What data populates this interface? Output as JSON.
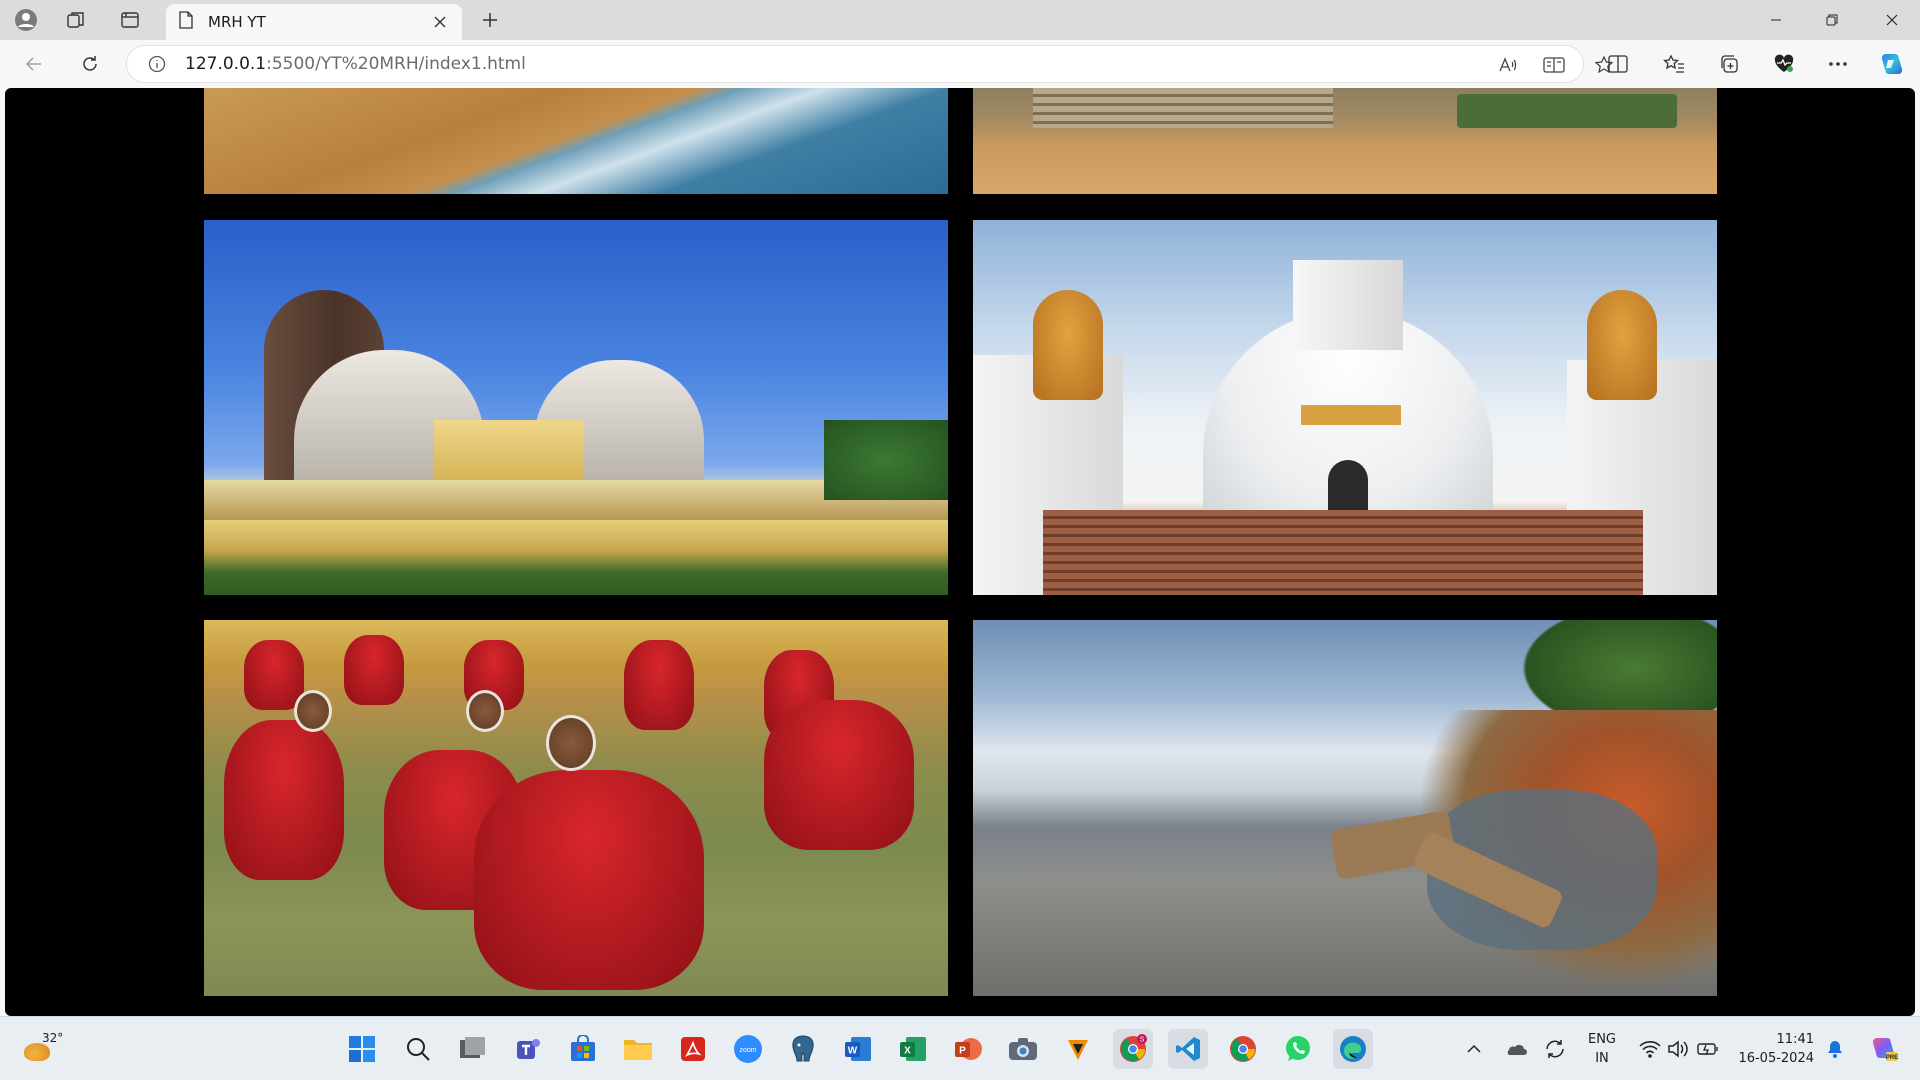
{
  "browser": {
    "tab_title": "MRH YT",
    "url_host": "127.0.0.1",
    "url_rest": ":5500/YT%20MRH/index1.html"
  },
  "gallery": {
    "images": [
      {
        "subject": "beach shoreline (partially scrolled)"
      },
      {
        "subject": "stone steps with visitors (partially scrolled)"
      },
      {
        "subject": "temple complex under blue sky"
      },
      {
        "subject": "white peace pagoda with lion statues"
      },
      {
        "subject": "odissi dancers on field"
      },
      {
        "subject": "rocky coastline at low tide"
      }
    ]
  },
  "taskbar": {
    "temperature": "32°",
    "language_line1": "ENG",
    "language_line2": "IN",
    "time": "11:41",
    "date": "16-05-2024",
    "apps": [
      "start",
      "search",
      "task-view",
      "teams",
      "store",
      "file-explorer",
      "acrobat",
      "zoom",
      "postgres",
      "word",
      "excel",
      "powerpoint",
      "camera",
      "vlc",
      "chrome-profile",
      "vscode",
      "chrome",
      "whatsapp",
      "edge"
    ]
  },
  "colors": {
    "page_background": "#000000",
    "taskbar": "#e9eef3",
    "tabstrip": "#dcdcdc"
  }
}
